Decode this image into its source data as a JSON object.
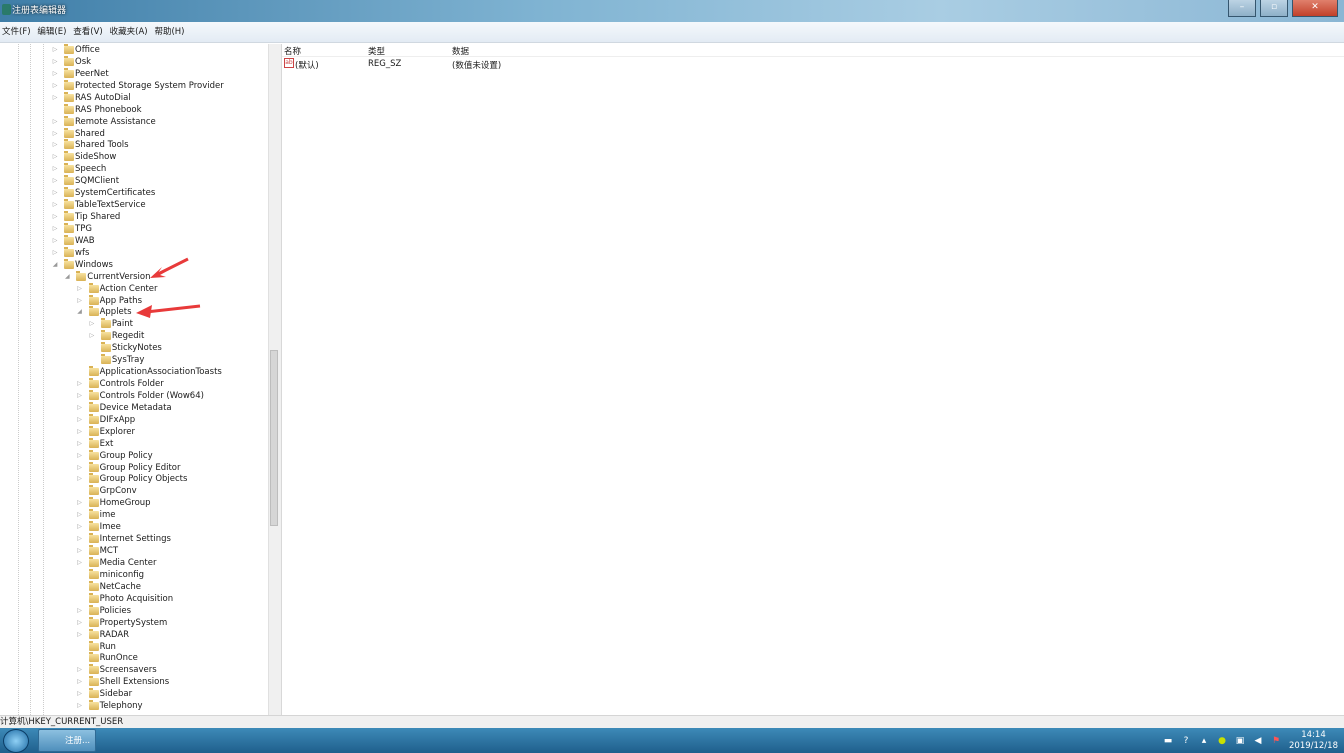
{
  "window": {
    "title": "注册表编辑器",
    "minimize": "–",
    "maximize": "▫",
    "close": "✕"
  },
  "menu": [
    "文件(F)",
    "编辑(E)",
    "查看(V)",
    "收藏夹(A)",
    "帮助(H)"
  ],
  "tree": [
    {
      "label": "Office",
      "level": 0,
      "arrow": "▷"
    },
    {
      "label": "Osk",
      "level": 0,
      "arrow": "▷"
    },
    {
      "label": "PeerNet",
      "level": 0,
      "arrow": "▷"
    },
    {
      "label": "Protected Storage System Provider",
      "level": 0,
      "arrow": "▷"
    },
    {
      "label": "RAS AutoDial",
      "level": 0,
      "arrow": "▷"
    },
    {
      "label": "RAS Phonebook",
      "level": 0,
      "arrow": ""
    },
    {
      "label": "Remote Assistance",
      "level": 0,
      "arrow": "▷"
    },
    {
      "label": "Shared",
      "level": 0,
      "arrow": "▷"
    },
    {
      "label": "Shared Tools",
      "level": 0,
      "arrow": "▷"
    },
    {
      "label": "SideShow",
      "level": 0,
      "arrow": "▷"
    },
    {
      "label": "Speech",
      "level": 0,
      "arrow": "▷"
    },
    {
      "label": "SQMClient",
      "level": 0,
      "arrow": "▷"
    },
    {
      "label": "SystemCertificates",
      "level": 0,
      "arrow": "▷"
    },
    {
      "label": "TableTextService",
      "level": 0,
      "arrow": "▷"
    },
    {
      "label": "Tip Shared",
      "level": 0,
      "arrow": "▷"
    },
    {
      "label": "TPG",
      "level": 0,
      "arrow": "▷"
    },
    {
      "label": "WAB",
      "level": 0,
      "arrow": "▷"
    },
    {
      "label": "wfs",
      "level": 0,
      "arrow": "▷"
    },
    {
      "label": "Windows",
      "level": 0,
      "arrow": "◢"
    },
    {
      "label": "CurrentVersion",
      "level": 1,
      "arrow": "◢"
    },
    {
      "label": "Action Center",
      "level": 2,
      "arrow": "▷"
    },
    {
      "label": "App Paths",
      "level": 2,
      "arrow": "▷"
    },
    {
      "label": "Applets",
      "level": 2,
      "arrow": "◢"
    },
    {
      "label": "Paint",
      "level": 3,
      "arrow": "▷"
    },
    {
      "label": "Regedit",
      "level": 3,
      "arrow": "▷"
    },
    {
      "label": "StickyNotes",
      "level": 3,
      "arrow": ""
    },
    {
      "label": "SysTray",
      "level": 3,
      "arrow": ""
    },
    {
      "label": "ApplicationAssociationToasts",
      "level": 2,
      "arrow": ""
    },
    {
      "label": "Controls Folder",
      "level": 2,
      "arrow": "▷"
    },
    {
      "label": "Controls Folder (Wow64)",
      "level": 2,
      "arrow": "▷"
    },
    {
      "label": "Device Metadata",
      "level": 2,
      "arrow": "▷"
    },
    {
      "label": "DIFxApp",
      "level": 2,
      "arrow": "▷"
    },
    {
      "label": "Explorer",
      "level": 2,
      "arrow": "▷"
    },
    {
      "label": "Ext",
      "level": 2,
      "arrow": "▷"
    },
    {
      "label": "Group Policy",
      "level": 2,
      "arrow": "▷"
    },
    {
      "label": "Group Policy Editor",
      "level": 2,
      "arrow": "▷"
    },
    {
      "label": "Group Policy Objects",
      "level": 2,
      "arrow": "▷"
    },
    {
      "label": "GrpConv",
      "level": 2,
      "arrow": ""
    },
    {
      "label": "HomeGroup",
      "level": 2,
      "arrow": "▷"
    },
    {
      "label": "ime",
      "level": 2,
      "arrow": "▷"
    },
    {
      "label": "Imee",
      "level": 2,
      "arrow": "▷"
    },
    {
      "label": "Internet Settings",
      "level": 2,
      "arrow": "▷"
    },
    {
      "label": "MCT",
      "level": 2,
      "arrow": "▷"
    },
    {
      "label": "Media Center",
      "level": 2,
      "arrow": "▷"
    },
    {
      "label": "miniconfig",
      "level": 2,
      "arrow": ""
    },
    {
      "label": "NetCache",
      "level": 2,
      "arrow": ""
    },
    {
      "label": "Photo Acquisition",
      "level": 2,
      "arrow": ""
    },
    {
      "label": "Policies",
      "level": 2,
      "arrow": "▷"
    },
    {
      "label": "PropertySystem",
      "level": 2,
      "arrow": "▷"
    },
    {
      "label": "RADAR",
      "level": 2,
      "arrow": "▷"
    },
    {
      "label": "Run",
      "level": 2,
      "arrow": ""
    },
    {
      "label": "RunOnce",
      "level": 2,
      "arrow": ""
    },
    {
      "label": "Screensavers",
      "level": 2,
      "arrow": "▷"
    },
    {
      "label": "Shell Extensions",
      "level": 2,
      "arrow": "▷"
    },
    {
      "label": "Sidebar",
      "level": 2,
      "arrow": "▷"
    },
    {
      "label": "Telephony",
      "level": 2,
      "arrow": "▷"
    }
  ],
  "list": {
    "columns": [
      "名称",
      "类型",
      "数据"
    ],
    "rows": [
      {
        "name": "(默认)",
        "type": "REG_SZ",
        "data": "(数值未设置)",
        "icon": "ab"
      }
    ]
  },
  "status": "计算机\\HKEY_CURRENT_USER",
  "taskbar": {
    "item": "注册...",
    "time": "14:14",
    "date": "2019/12/18"
  },
  "colors": {
    "annotation_arrow": "#e83a3a"
  }
}
